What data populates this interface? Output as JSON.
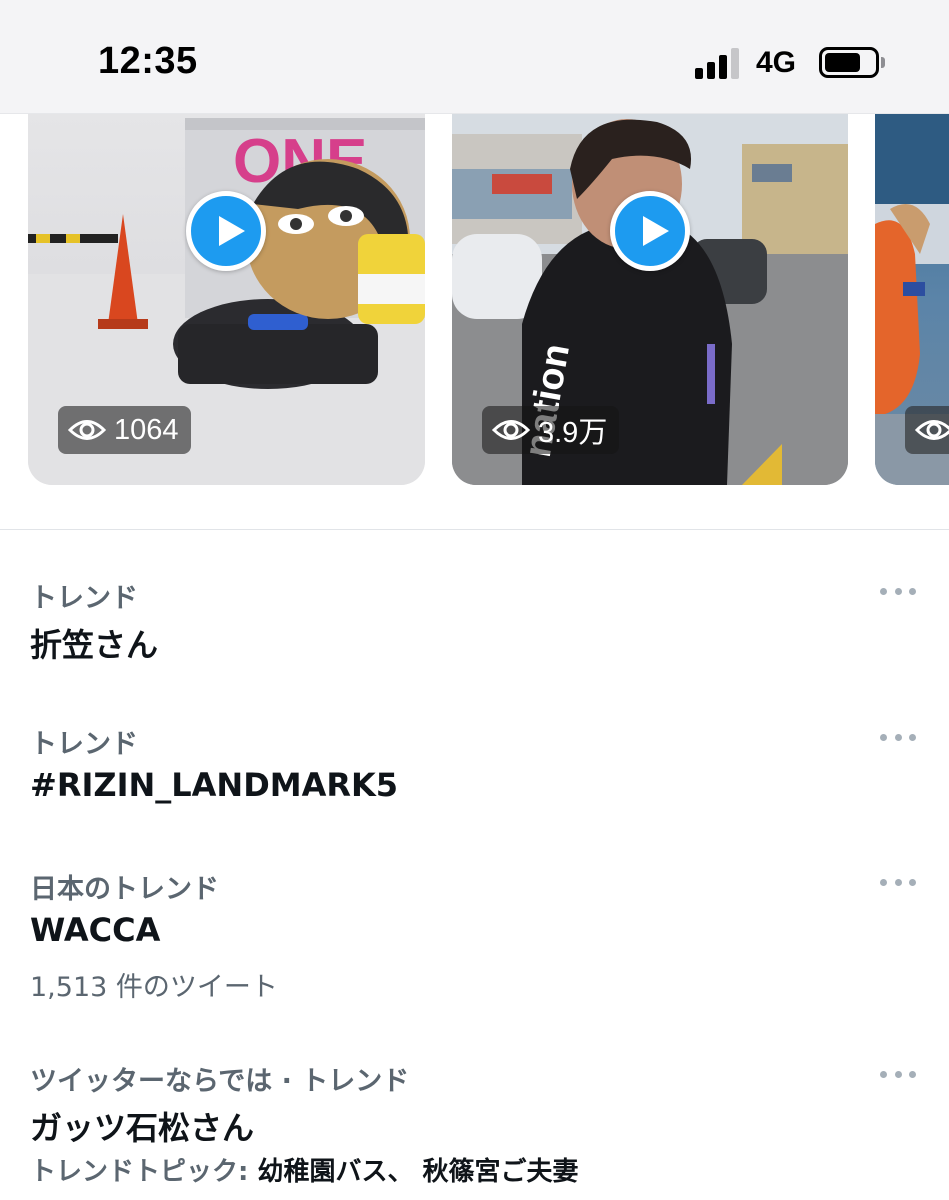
{
  "status_bar": {
    "time": "12:35",
    "network": "4G",
    "battery_level": 0.72
  },
  "videos": [
    {
      "views": "1064",
      "icon": "play-icon"
    },
    {
      "views": "3.9万",
      "icon": "play-icon"
    },
    {
      "views": "",
      "icon": "eye-icon"
    }
  ],
  "trends": [
    {
      "context": "トレンド",
      "title": "折笠さん"
    },
    {
      "context": "トレンド",
      "title": "#RIZIN_LANDMARK5"
    },
    {
      "context": "日本のトレンド",
      "title": "WACCA",
      "meta": "1,513 件のツイート"
    },
    {
      "context": "ツイッターならでは · トレンド",
      "title": "ガッツ石松さん",
      "topics_label": "トレンドトピック: ",
      "topics_value": "幼稚園バス、 秋篠宮ご夫妻"
    }
  ],
  "colors": {
    "accent": "#1d9bf0",
    "primary_text": "#0f1419",
    "secondary_text": "#5b6670"
  }
}
